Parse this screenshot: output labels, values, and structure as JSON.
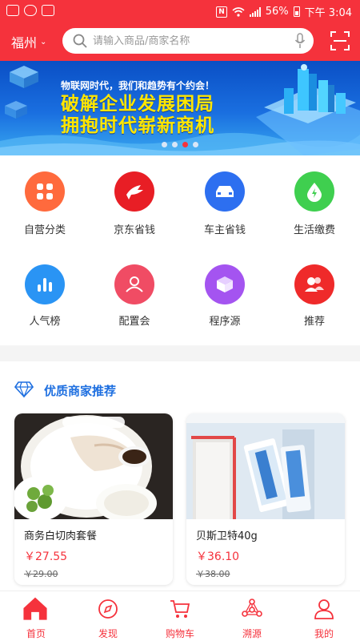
{
  "status_bar": {
    "battery": "56%",
    "time": "下午 3:04",
    "nfc": "N"
  },
  "header": {
    "city": "福州",
    "search_placeholder": "请输入商品/商家名称"
  },
  "banner": {
    "small_text": "物联网时代，我们和趋势有个约会！",
    "line1": "破解企业发展困局",
    "line2": "拥抱时代崭新商机",
    "page_count": 4,
    "active_index": 2
  },
  "categories": [
    {
      "label": "自营分类",
      "icon": "grid-icon",
      "color": "#ff6a3d"
    },
    {
      "label": "京东省钱",
      "icon": "jd-dog-icon",
      "color": "#e81e25"
    },
    {
      "label": "车主省钱",
      "icon": "car-icon",
      "color": "#2d6ff0"
    },
    {
      "label": "生活缴费",
      "icon": "water-drop-icon",
      "color": "#3fcf4f"
    },
    {
      "label": "人气榜",
      "icon": "bar-chart-icon",
      "color": "#2a94f4"
    },
    {
      "label": "配置会",
      "icon": "meeting-icon",
      "color": "#f04c64"
    },
    {
      "label": "程序源",
      "icon": "cube-icon",
      "color": "#a454f0"
    },
    {
      "label": "推荐",
      "icon": "users-icon",
      "color": "#ef2a2a"
    }
  ],
  "recommend": {
    "title": "优质商家推荐",
    "icon": "diamond-icon",
    "items": [
      {
        "name": "商务白切肉套餐",
        "price": "￥27.55",
        "original_price": "￥29.00"
      },
      {
        "name": "贝斯卫特40g",
        "price": "￥36.10",
        "original_price": "￥38.00"
      }
    ]
  },
  "tabs": [
    {
      "label": "首页",
      "icon": "home-icon"
    },
    {
      "label": "发现",
      "icon": "compass-icon"
    },
    {
      "label": "购物车",
      "icon": "cart-icon"
    },
    {
      "label": "溯源",
      "icon": "trace-network-icon"
    },
    {
      "label": "我的",
      "icon": "user-icon"
    }
  ],
  "colors": {
    "brand": "#f5323c",
    "accent_blue": "#1e6fe0"
  }
}
